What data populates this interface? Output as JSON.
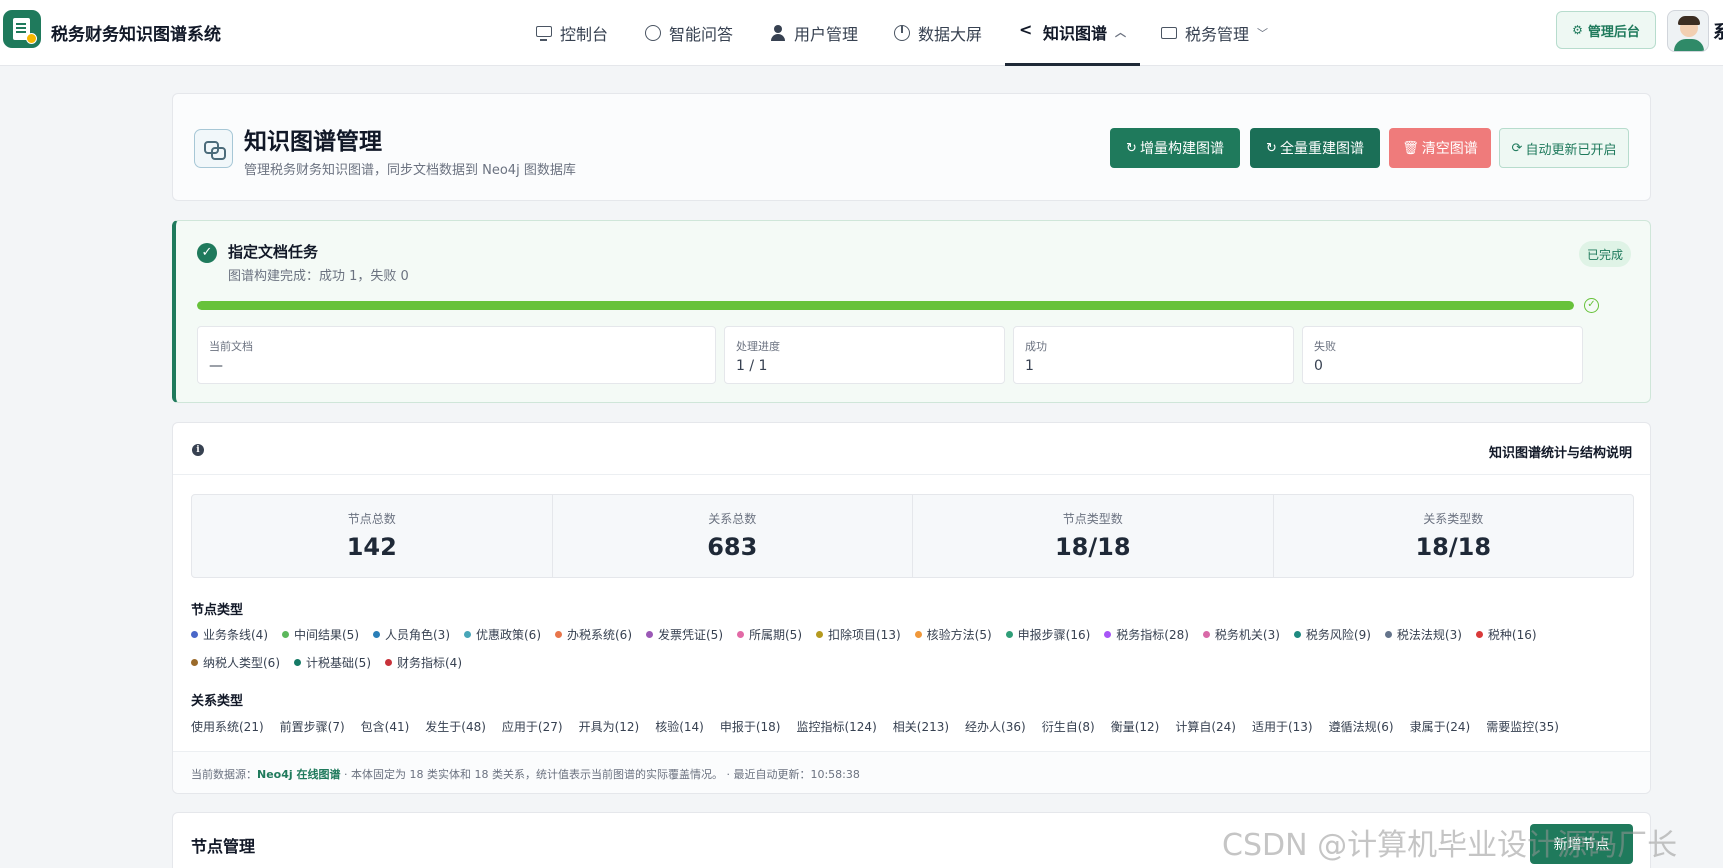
{
  "brand": {
    "name": "税务财务知识图谱系统"
  },
  "nav": {
    "items": [
      {
        "label": "控制台",
        "icon": "monitor-icon"
      },
      {
        "label": "智能问答",
        "icon": "chat-icon"
      },
      {
        "label": "用户管理",
        "icon": "user-icon"
      },
      {
        "label": "数据大屏",
        "icon": "pie-chart-icon"
      },
      {
        "label": "知识图谱",
        "icon": "share-icon",
        "active": true
      },
      {
        "label": "税务管理",
        "icon": "folder-icon"
      }
    ],
    "admin_label": "管理后台",
    "user_name": "系"
  },
  "header": {
    "title": "知识图谱管理",
    "subtitle": "管理税务财务知识图谱，同步文档数据到 Neo4j 图数据库",
    "buttons": {
      "incremental": "增量构建图谱",
      "rebuild": "全量重建图谱",
      "clear": "清空图谱",
      "auto": "自动更新已开启"
    }
  },
  "task": {
    "title": "指定文档任务",
    "summary": "图谱构建完成：成功 1，失败 0",
    "status": "已完成",
    "progress": 1.0,
    "stats": [
      {
        "label": "当前文档",
        "value": "—"
      },
      {
        "label": "处理进度",
        "value": "1 / 1"
      },
      {
        "label": "成功",
        "value": "1"
      },
      {
        "label": "失败",
        "value": "0"
      }
    ]
  },
  "stats": {
    "title": "知识图谱统计与结构说明",
    "kpis": [
      {
        "label": "节点总数",
        "value": "142"
      },
      {
        "label": "关系总数",
        "value": "683"
      },
      {
        "label": "节点类型数",
        "value": "18/18"
      },
      {
        "label": "关系类型数",
        "value": "18/18"
      }
    ],
    "node_types_title": "节点类型",
    "node_types": [
      {
        "label": "业务条线(4)",
        "color": "#4a67c8"
      },
      {
        "label": "中间结果(5)",
        "color": "#5cb85c"
      },
      {
        "label": "人员角色(3)",
        "color": "#2a7fb8"
      },
      {
        "label": "优惠政策(6)",
        "color": "#48a6b8"
      },
      {
        "label": "办税系统(6)",
        "color": "#e8764b"
      },
      {
        "label": "发票凭证(5)",
        "color": "#9b59b6"
      },
      {
        "label": "所属期(5)",
        "color": "#e26aa6"
      },
      {
        "label": "扣除项目(13)",
        "color": "#b59a1f"
      },
      {
        "label": "核验方法(5)",
        "color": "#f0983a"
      },
      {
        "label": "申报步骤(16)",
        "color": "#2f9e78"
      },
      {
        "label": "税务指标(28)",
        "color": "#a855f7"
      },
      {
        "label": "税务机关(3)",
        "color": "#d96aa8"
      },
      {
        "label": "税务风险(9)",
        "color": "#1f8a80"
      },
      {
        "label": "税法法规(3)",
        "color": "#64748b"
      },
      {
        "label": "税种(16)",
        "color": "#d93a3a"
      },
      {
        "label": "纳税人类型(6)",
        "color": "#9a6a2a"
      },
      {
        "label": "计税基础(5)",
        "color": "#157a66"
      },
      {
        "label": "财务指标(4)",
        "color": "#c8323a"
      }
    ],
    "relation_types_title": "关系类型",
    "relation_types": [
      "使用系统(21)",
      "前置步骤(7)",
      "包含(41)",
      "发生于(48)",
      "应用于(27)",
      "开具为(12)",
      "核验(14)",
      "申报于(18)",
      "监控指标(124)",
      "相关(213)",
      "经办人(36)",
      "衍生自(8)",
      "衡量(12)",
      "计算自(24)",
      "适用于(13)",
      "遵循法规(6)",
      "隶属于(24)",
      "需要监控(35)"
    ],
    "footer": {
      "prefix": "当前数据源：",
      "source": "Neo4j 在线图谱",
      "rest": " · 本体固定为 18 类实体和 18 类关系，统计值表示当前图谱的实际覆盖情况。 · 最近自动更新：10:58:38"
    }
  },
  "nodes": {
    "title": "节点管理",
    "add_label": "新增节点"
  },
  "watermark": "CSDN @计算机毕业设计源码厂长"
}
